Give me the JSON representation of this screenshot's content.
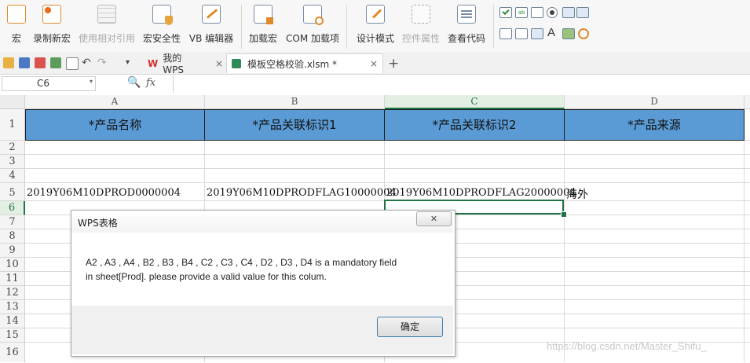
{
  "ribbon": {
    "buttons": [
      {
        "label": "宏",
        "icon": "macro-icon"
      },
      {
        "label": "录制新宏",
        "icon": "record-macro-icon"
      },
      {
        "label": "使用相对引用",
        "icon": "relative-reference-icon"
      },
      {
        "label": "宏安全性",
        "icon": "macro-security-icon"
      },
      {
        "label": "VB 编辑器",
        "icon": "vb-editor-icon"
      },
      {
        "label": "加载宏",
        "icon": "add-in-icon"
      },
      {
        "label": "COM 加载项",
        "icon": "com-add-in-icon"
      },
      {
        "label": "设计模式",
        "icon": "design-mode-icon"
      },
      {
        "label": "控件属性",
        "icon": "control-properties-icon"
      },
      {
        "label": "查看代码",
        "icon": "view-code-icon"
      }
    ],
    "controls_letter": "A"
  },
  "tabs": {
    "home": "我的WPS",
    "file": "模板空格校验.xlsm *",
    "close": "×",
    "add": "+"
  },
  "formula": {
    "name_box": "C6",
    "fx": "fx",
    "value": ""
  },
  "sheet": {
    "columns": [
      "A",
      "B",
      "C",
      "D"
    ],
    "rows": [
      "1",
      "2",
      "3",
      "4",
      "5",
      "6",
      "7",
      "8",
      "9",
      "10",
      "11",
      "12",
      "13",
      "14",
      "15",
      "16"
    ],
    "headers": [
      "*产品名称",
      "*产品关联标识1",
      "*产品关联标识2",
      "*产品来源"
    ],
    "row5": [
      "2019Y06M10DPROD0000004",
      "2019Y06M10DPRODFLAG10000004",
      "2019Y06M10DPRODFLAG20000004",
      "海外"
    ],
    "selected_cell": "C6"
  },
  "dialog": {
    "title": "WPS表格",
    "close": "✕",
    "message_line1": "A2 , A3 , A4 , B2 , B3 , B4 , C2 , C3 , C4 , D2 , D3 , D4 is a mandatory field",
    "message_line2": "in sheet[Prod]. please provide a valid value for this colum.",
    "ok_label": "确定"
  },
  "watermark": "https://blog.csdn.net/Master_Shifu_",
  "colors": {
    "header_fill": "#5b9bd5",
    "selection": "#217346"
  }
}
